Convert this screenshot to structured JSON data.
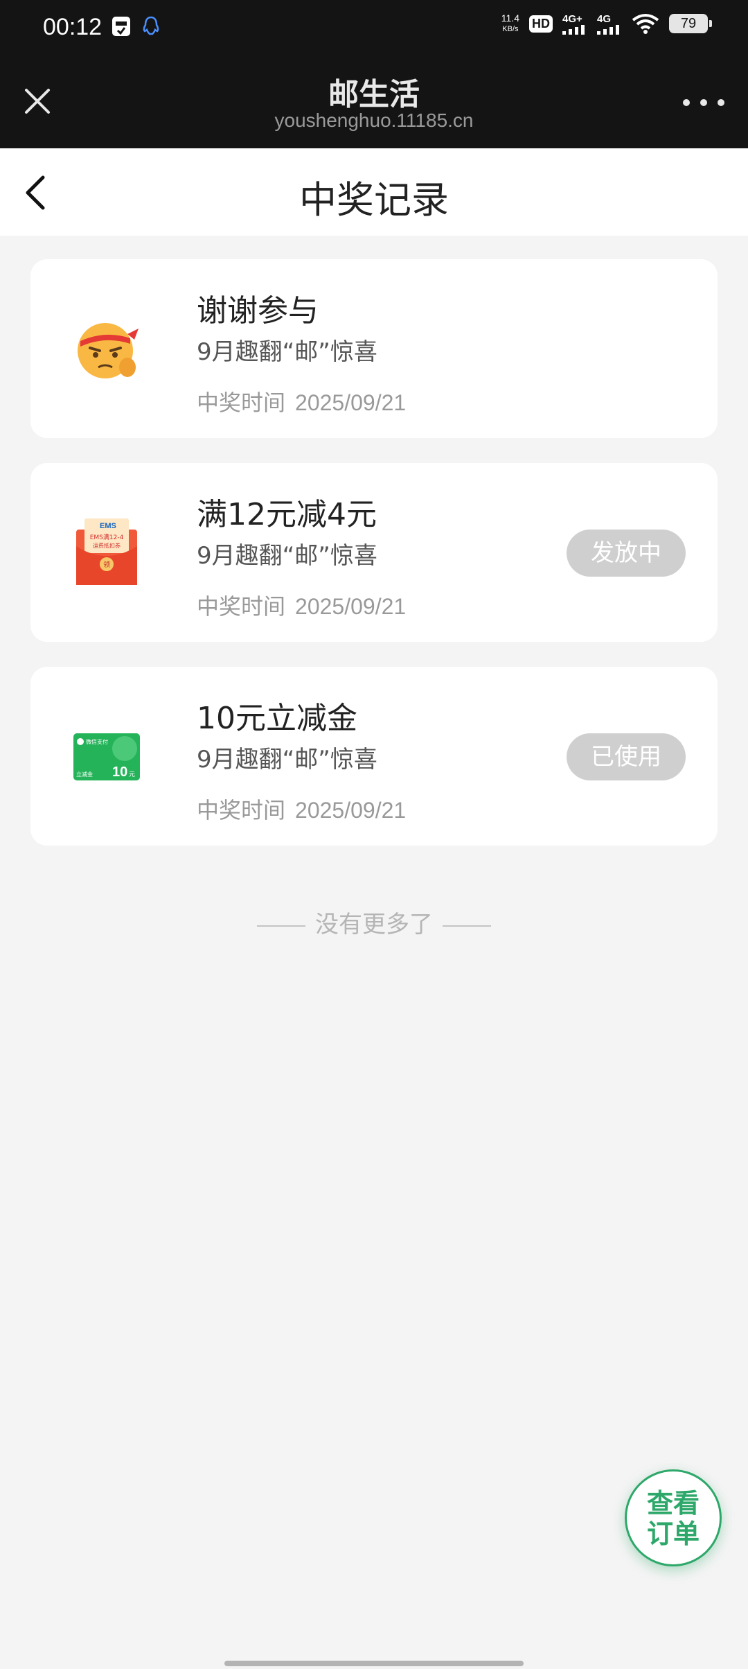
{
  "status_bar": {
    "time": "00:12",
    "speed_value": "11.4",
    "speed_unit": "KB/s",
    "hd_label": "HD",
    "network_1": "4G+",
    "network_2": "4G",
    "battery": "79",
    "icons": [
      "sim-card-icon",
      "qq-icon",
      "hd-icon",
      "signal-icon",
      "wifi-icon",
      "battery-icon"
    ]
  },
  "browser": {
    "title": "邮生活",
    "url": "youshenghuo.11185.cn",
    "close_icon": "close-icon",
    "more_icon": "more-icon"
  },
  "header": {
    "title": "中奖记录",
    "back_icon": "back-icon"
  },
  "records": [
    {
      "title": "谢谢参与",
      "subtitle": "9月趣翻“邮”惊喜",
      "time_label": "中奖时间",
      "time_value": "2025/09/21",
      "status": "",
      "icon": "emoji-face-icon"
    },
    {
      "title": "满12元减4元",
      "subtitle": "9月趣翻“邮”惊喜",
      "time_label": "中奖时间",
      "time_value": "2025/09/21",
      "status": "发放中",
      "icon": "ems-red-envelope-icon",
      "icon_text": {
        "brand": "EMS",
        "line1": "EMS满12-4",
        "line2": "运费抵扣券",
        "seal": "领"
      }
    },
    {
      "title": "10元立减金",
      "subtitle": "9月趣翻“邮”惊喜",
      "time_label": "中奖时间",
      "time_value": "2025/09/21",
      "status": "已使用",
      "icon": "wechat-pay-card-icon",
      "icon_text": {
        "brand": "微信支付",
        "label": "立减金",
        "amount": "10",
        "unit": "元"
      }
    }
  ],
  "no_more_text": "没有更多了",
  "fab": {
    "line1": "查看",
    "line2": "订单"
  },
  "colors": {
    "accent": "#2ea86a",
    "status_bg": "#cfcfcf",
    "page_bg": "#f4f4f4",
    "dark_bar": "#141414"
  }
}
